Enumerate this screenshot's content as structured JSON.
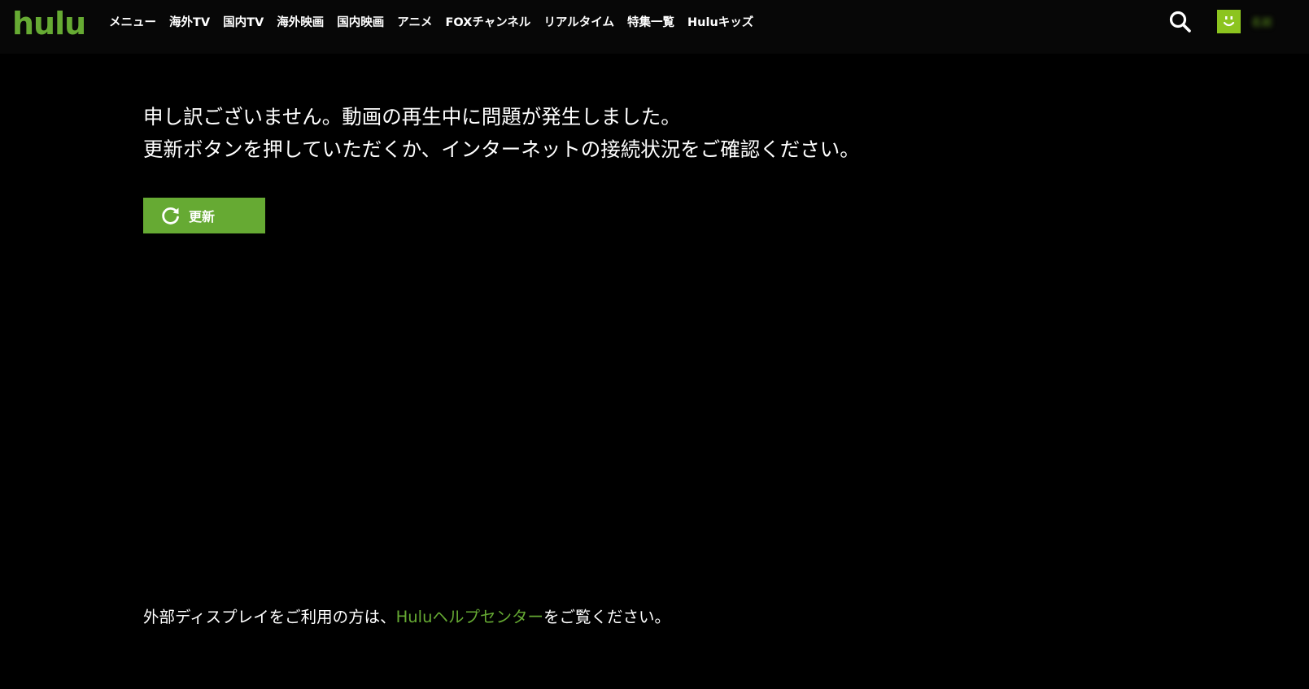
{
  "header": {
    "logo_text": "hulu",
    "nav": [
      {
        "label": "メニュー"
      },
      {
        "label": "海外TV"
      },
      {
        "label": "国内TV"
      },
      {
        "label": "海外映画"
      },
      {
        "label": "国内映画"
      },
      {
        "label": "アニメ"
      },
      {
        "label": "FOXチャンネル"
      },
      {
        "label": "リアルタイム"
      },
      {
        "label": "特集一覧"
      },
      {
        "label": "Huluキッズ"
      }
    ],
    "search_icon": "search-icon",
    "avatar_icon": "smiley-face-icon",
    "username": "名前"
  },
  "main": {
    "message_line1": "申し訳ございません。動画の再生中に問題が発生しました。",
    "message_line2": "更新ボタンを押していただくか、インターネットの接続状況をご確認ください。",
    "refresh_button": {
      "label": "更新",
      "icon": "refresh-icon"
    }
  },
  "footer": {
    "text_before": "外部ディスプレイをご利用の方は、",
    "link_text": "Huluヘルプセンター",
    "text_after": "をご覧ください。"
  },
  "colors": {
    "background": "#000000",
    "header_bg": "#070707",
    "accent_green": "#66aa33",
    "avatar_green": "#8cc41f",
    "text": "#ffffff"
  }
}
